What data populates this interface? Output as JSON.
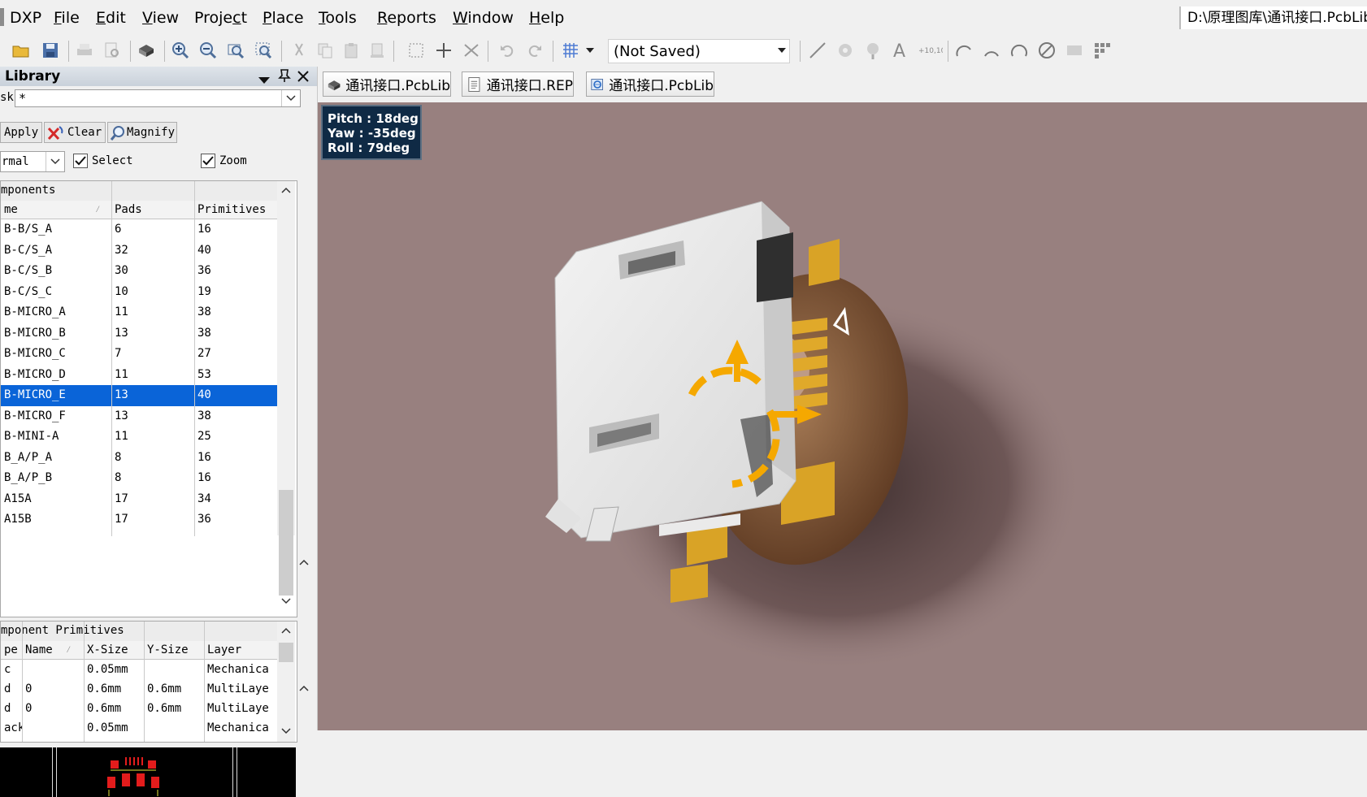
{
  "menubar": {
    "app": "DXP",
    "items": [
      {
        "label": "File",
        "key": "F"
      },
      {
        "label": "Edit",
        "key": "E"
      },
      {
        "label": "View",
        "key": "V"
      },
      {
        "label": "Project",
        "key": "c"
      },
      {
        "label": "Place",
        "key": "P"
      },
      {
        "label": "Tools",
        "key": "T"
      },
      {
        "label": "Reports",
        "key": "R"
      },
      {
        "label": "Window",
        "key": "W"
      },
      {
        "label": "Help",
        "key": "H"
      }
    ],
    "path": "D:\\原理图库\\通讯接口.PcbLib"
  },
  "toolbar": {
    "view_config": "(Not Saved)"
  },
  "library_panel": {
    "title": "Library",
    "mask_label": "sk",
    "mask_value": "*",
    "apply_label": "Apply",
    "clear_label": "Clear",
    "magnify_label": "Magnify",
    "mode_value": "rmal",
    "select_label": "Select",
    "zoom_label": "Zoom",
    "components": {
      "section_title": "mponents",
      "columns": [
        "me",
        "Pads",
        "Primitives"
      ],
      "rows": [
        {
          "name": "B-B/S_A",
          "pads": "6",
          "prims": "16"
        },
        {
          "name": "B-C/S_A",
          "pads": "32",
          "prims": "40"
        },
        {
          "name": "B-C/S_B",
          "pads": "30",
          "prims": "36"
        },
        {
          "name": "B-C/S_C",
          "pads": "10",
          "prims": "19"
        },
        {
          "name": "B-MICRO_A",
          "pads": "11",
          "prims": "38"
        },
        {
          "name": "B-MICRO_B",
          "pads": "13",
          "prims": "38"
        },
        {
          "name": "B-MICRO_C",
          "pads": "7",
          "prims": "27"
        },
        {
          "name": "B-MICRO_D",
          "pads": "11",
          "prims": "53"
        },
        {
          "name": "B-MICRO_E",
          "pads": "13",
          "prims": "40"
        },
        {
          "name": "B-MICRO_F",
          "pads": "13",
          "prims": "38"
        },
        {
          "name": "B-MINI-A",
          "pads": "11",
          "prims": "25"
        },
        {
          "name": "B_A/P_A",
          "pads": "8",
          "prims": "16"
        },
        {
          "name": "B_A/P_B",
          "pads": "8",
          "prims": "16"
        },
        {
          "name": "A15A",
          "pads": "17",
          "prims": "34"
        },
        {
          "name": "A15B",
          "pads": "17",
          "prims": "36"
        }
      ],
      "selected_index": 8
    },
    "primitives": {
      "section_title": "mponent Primitives",
      "columns": [
        "pe",
        "Name",
        "X-Size",
        "Y-Size",
        "Layer"
      ],
      "rows": [
        {
          "type": "c",
          "name": "",
          "x": "0.05mm",
          "y": "",
          "layer": "Mechanica"
        },
        {
          "type": "d",
          "name": "0",
          "x": "0.6mm",
          "y": "0.6mm",
          "layer": "MultiLaye"
        },
        {
          "type": "d",
          "name": "0",
          "x": "0.6mm",
          "y": "0.6mm",
          "layer": "MultiLaye"
        },
        {
          "type": "ack",
          "name": "",
          "x": "0.05mm",
          "y": "",
          "layer": "Mechanica"
        }
      ]
    }
  },
  "doc_tabs": [
    {
      "label": "通讯接口.PcbLib",
      "icon": "pcb-3d-icon"
    },
    {
      "label": "通讯接口.REP",
      "icon": "document-icon"
    },
    {
      "label": "通讯接口.PcbLib",
      "icon": "browser-icon"
    }
  ],
  "viewport": {
    "pitch": "Pitch : 18deg",
    "yaw": "Yaw : -35deg",
    "roll": "Roll : 79deg",
    "colors": {
      "background": "#98807f",
      "body": "#ececec",
      "pads": "#d9a326",
      "gizmo": "#f5a800"
    }
  }
}
